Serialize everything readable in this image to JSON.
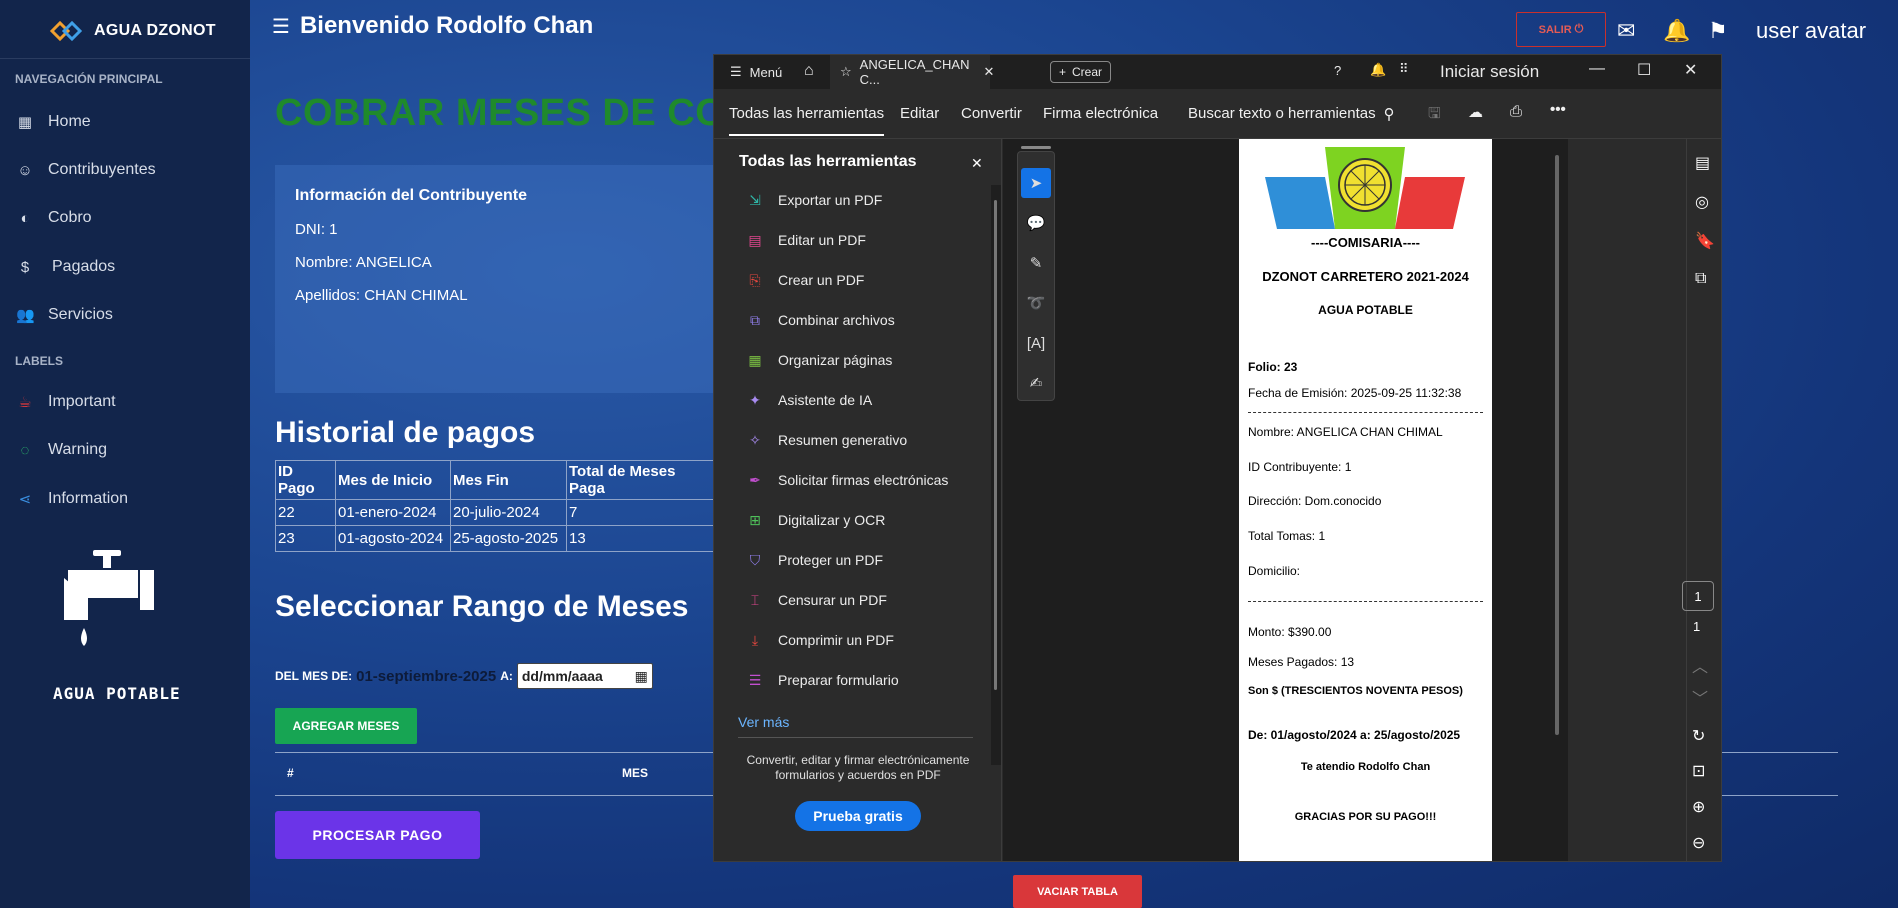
{
  "sidebar": {
    "brand": "AGUA DZONOT",
    "nav_heading": "NAVEGACIÓN PRINCIPAL",
    "items": [
      {
        "label": "Home",
        "icon": "dashboard-icon"
      },
      {
        "label": "Contribuyentes",
        "icon": "smile-icon"
      },
      {
        "label": "Cobro",
        "icon": "half-circle-icon"
      },
      {
        "label": "Pagados",
        "icon": "dollar-icon"
      },
      {
        "label": "Servicios",
        "icon": "users-icon"
      }
    ],
    "labels_heading": "LABELS",
    "labels": [
      {
        "label": "Important",
        "color": "#e4393c"
      },
      {
        "label": "Warning",
        "color": "#2ecc71"
      },
      {
        "label": "Information",
        "color": "#3a8fe0"
      }
    ],
    "logo_text": "AGUA POTABLE"
  },
  "header": {
    "title": "Bienvenido Rodolfo Chan",
    "salir": "SALIR",
    "avatar": "user avatar"
  },
  "main": {
    "page_title": "COBRAR MESES DE CONT",
    "info": {
      "heading": "Información del Contribuyente",
      "dni": "DNI: 1",
      "nombre": "Nombre: ANGELICA",
      "apellidos": "Apellidos: CHAN CHIMAL"
    },
    "historial_title": "Historial de pagos",
    "historial_headers": [
      "ID Pago",
      "Mes de Inicio",
      "Mes Fin",
      "Total de Meses Paga"
    ],
    "historial_rows": [
      [
        "22",
        "01-enero-2024",
        "20-julio-2024",
        "7"
      ],
      [
        "23",
        "01-agosto-2024",
        "25-agosto-2025",
        "13"
      ]
    ],
    "rango_title": "Seleccionar Rango de Meses",
    "del_mes_label": "DEL MES DE:",
    "del_mes_value": "01-septiembre-2025",
    "a_label": "A:",
    "date_placeholder": "dd/mm/aaaa",
    "agregar_btn": "AGREGAR MESES",
    "col_num": "#",
    "col_mes": "MES",
    "procesar_btn": "PROCESAR PAGO",
    "vaciar_btn": "VACIAR TABLA"
  },
  "acrobat": {
    "menu": "Menú",
    "tab_title": "ANGELICA_CHAN C...",
    "crear": "Crear",
    "iniciar": "Iniciar sesión",
    "menus": [
      "Todas las herramientas",
      "Editar",
      "Convertir",
      "Firma electrónica"
    ],
    "search": "Buscar texto o herramientas",
    "panel_title": "Todas las herramientas",
    "tools": [
      {
        "label": "Exportar un PDF",
        "color": "#2fb7a8"
      },
      {
        "label": "Editar un PDF",
        "color": "#e0468f"
      },
      {
        "label": "Crear un PDF",
        "color": "#e8473f"
      },
      {
        "label": "Combinar archivos",
        "color": "#8f7de8"
      },
      {
        "label": "Organizar páginas",
        "color": "#7bc043"
      },
      {
        "label": "Asistente de IA",
        "color": "#a88bf0"
      },
      {
        "label": "Resumen generativo",
        "color": "#a88bf0"
      },
      {
        "label": "Solicitar firmas electrónicas",
        "color": "#c34fd0"
      },
      {
        "label": "Digitalizar y OCR",
        "color": "#4fc15a"
      },
      {
        "label": "Proteger un PDF",
        "color": "#8f7de8"
      },
      {
        "label": "Censurar un PDF",
        "color": "#e0468f"
      },
      {
        "label": "Comprimir un PDF",
        "color": "#e8473f"
      },
      {
        "label": "Preparar formulario",
        "color": "#c34fd0"
      }
    ],
    "ver_mas": "Ver más",
    "promo": "Convertir, editar y firmar electrónicamente formularios y acuerdos en PDF",
    "prueba": "Prueba gratis",
    "page_current": "1",
    "page_total": "1"
  },
  "receipt": {
    "comisaria": "----COMISARIA----",
    "header": "DZONOT CARRETERO 2021-2024",
    "service": "AGUA POTABLE",
    "folio": "Folio: 23",
    "fecha": "Fecha de Emisión:  2025-09-25 11:32:38",
    "nombre": "Nombre: ANGELICA CHAN CHIMAL",
    "id": "ID Contribuyente: 1",
    "direccion": "Dirección:  Dom.conocido",
    "tomas": "Total Tomas: 1",
    "domicilio": "Domicilio:",
    "monto": "Monto: $390.00",
    "meses": "Meses Pagados:  13",
    "son": "Son $ (TRESCIENTOS NOVENTA  PESOS)",
    "periodo": "De: 01/agosto/2024 a: 25/agosto/2025",
    "atendio": "Te atendio Rodolfo Chan",
    "gracias": "GRACIAS POR SU PAGO!!!"
  }
}
